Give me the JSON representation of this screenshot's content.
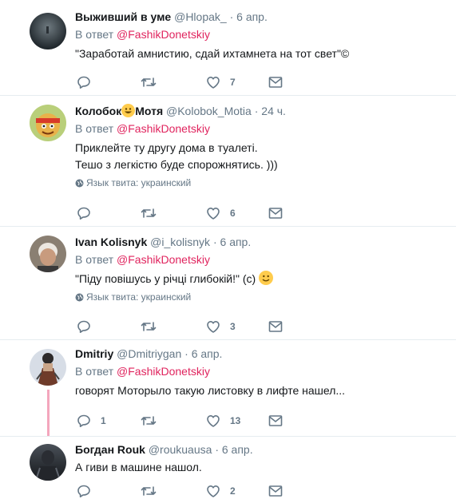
{
  "tweets": [
    {
      "name": "Выживший в уме",
      "handle": "@Hlopak_",
      "time": "6 апр.",
      "reply_prefix": "В ответ",
      "reply_to": "@FashikDonetskiy",
      "text_lines": [
        "\"Заработай амнистию, сдай ихтамнета на тот свет\"©"
      ],
      "counts": {
        "reply": "",
        "retweet": "",
        "like": "7"
      }
    },
    {
      "name": "Колобок",
      "name_suffix": "Мотя",
      "handle": "@Kolobok_Motia",
      "time": "24 ч.",
      "reply_prefix": "В ответ",
      "reply_to": "@FashikDonetskiy",
      "text_lines": [
        "Приклейте ту другу дома в туалеті.",
        "Тешо з легкістю буде спорожнятись. )))"
      ],
      "lang": "Язык твита: украинский",
      "counts": {
        "reply": "",
        "retweet": "",
        "like": "6"
      }
    },
    {
      "name": "Ivan Kolisnyk",
      "handle": "@i_kolisnyk",
      "time": "6 апр.",
      "reply_prefix": "В ответ",
      "reply_to": "@FashikDonetskiy",
      "text_lines": [
        "\"Піду повішусь у річці глибокій!\" (с)"
      ],
      "lang": "Язык твита: украинский",
      "counts": {
        "reply": "",
        "retweet": "",
        "like": "3"
      }
    },
    {
      "name": "Dmitriy",
      "handle": "@Dmitriygan",
      "time": "6 апр.",
      "reply_prefix": "В ответ",
      "reply_to": "@FashikDonetskiy",
      "text_lines": [
        "говорят Моторыло такую листовку в лифте нашел..."
      ],
      "counts": {
        "reply": "1",
        "retweet": "",
        "like": "13"
      }
    },
    {
      "name": "Богдан Rouk",
      "handle": "@roukuausa",
      "time": "6 апр.",
      "text_lines": [
        "А гиви в машине нашол."
      ],
      "counts": {
        "reply": "",
        "retweet": "",
        "like": "2"
      }
    }
  ],
  "separator": "·",
  "colors": {
    "mention": "#e0245e",
    "muted": "#657786",
    "thread": "#f4a6bd"
  }
}
